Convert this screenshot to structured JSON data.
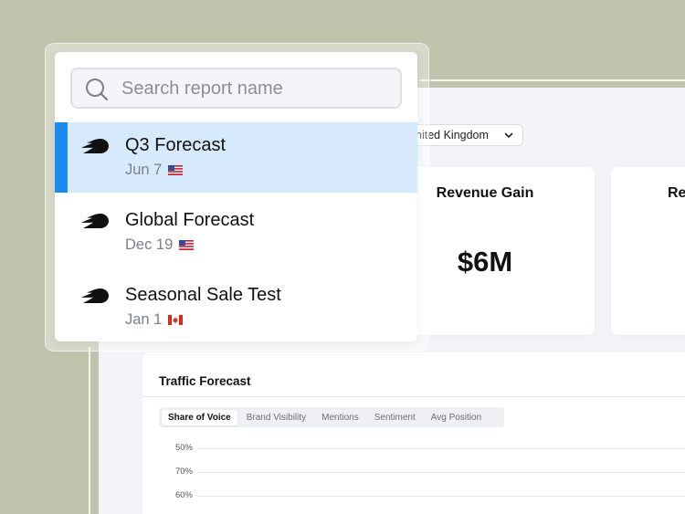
{
  "background": {
    "color": "#c1c4ad"
  },
  "dashboard": {
    "country_select": {
      "value": "nited Kingdom"
    },
    "cards": [
      {
        "title": "Revenue Gain",
        "value": "$6M"
      },
      {
        "title": "Re",
        "value": ""
      }
    ],
    "traffic_panel": {
      "title": "Traffic Forecast",
      "tabs": [
        {
          "label": "Share of Voice",
          "active": true
        },
        {
          "label": "Brand Visibility",
          "active": false
        },
        {
          "label": "Mentions",
          "active": false
        },
        {
          "label": "Sentiment",
          "active": false
        },
        {
          "label": "Avg Position",
          "active": false
        }
      ],
      "y_ticks": [
        "50%",
        "70%",
        "60%"
      ]
    }
  },
  "report_picker": {
    "search": {
      "placeholder": "Search report name",
      "value": ""
    },
    "reports": [
      {
        "name": "Q3 Forecast",
        "date": "Jun 7",
        "flag": "us-flag",
        "selected": true
      },
      {
        "name": "Global Forecast",
        "date": "Dec 19",
        "flag": "us-flag",
        "selected": false
      },
      {
        "name": "Seasonal Sale Test",
        "date": "Jan 1",
        "flag": "canada-flag",
        "selected": false
      }
    ],
    "accent_color": "#1a8cf0",
    "selected_bg": "#d6eafb"
  }
}
